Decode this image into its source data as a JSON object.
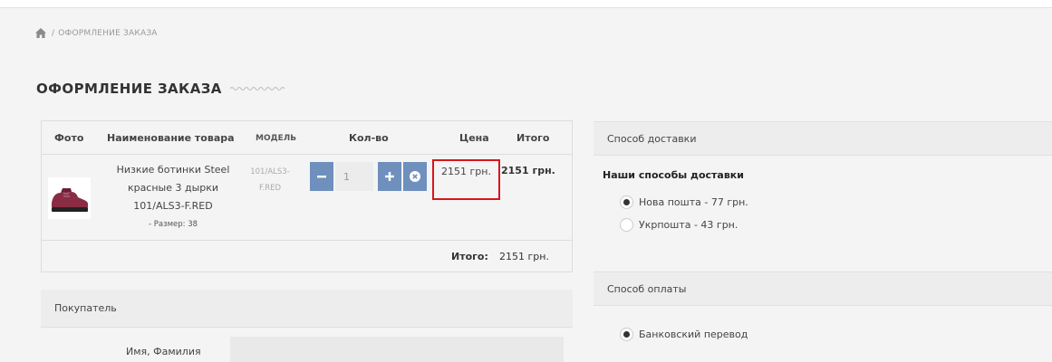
{
  "breadcrumb": {
    "current": "ОФОРМЛЕНИЕ ЗАКАЗА",
    "separator": "/"
  },
  "page_title": "ОФОРМЛЕНИЕ ЗАКАЗА",
  "cart": {
    "headers": {
      "photo": "Фото",
      "name": "Наименование товара",
      "model": "МОДЕЛЬ",
      "qty": "Кол-во",
      "price": "Цена",
      "total": "Итого"
    },
    "item": {
      "name_line1": "Низкие ботинки Steel",
      "name_line2": "красные 3 дырки",
      "name_line3": "101/ALS3-F.RED",
      "size": "- Размер: 38",
      "model_line1": "101/ALS3-",
      "model_line2": "F.RED",
      "quantity": "1",
      "price": "2151 грн.",
      "total": "2151 грн."
    },
    "footer": {
      "label": "Итого:",
      "value": "2151 грн."
    }
  },
  "buyer": {
    "title": "Покупатель",
    "name_label": "Имя, Фамилия"
  },
  "delivery": {
    "title": "Способ доставки",
    "subtitle": "Наши способы доставки",
    "options": [
      {
        "label": "Нова пошта - 77 грн.",
        "selected": true
      },
      {
        "label": "Укрпошта - 43 грн.",
        "selected": false
      }
    ]
  },
  "payment": {
    "title": "Способ оплаты",
    "options": [
      {
        "label": "Банковский перевод",
        "selected": true
      }
    ]
  },
  "colors": {
    "button": "#6f8fbd",
    "highlight": "#d6161c",
    "background": "#f4f4f4"
  },
  "icons": {
    "home": "home-icon",
    "minus": "minus-icon",
    "plus": "plus-icon",
    "remove": "remove-icon",
    "wave": "wave-decoration"
  }
}
